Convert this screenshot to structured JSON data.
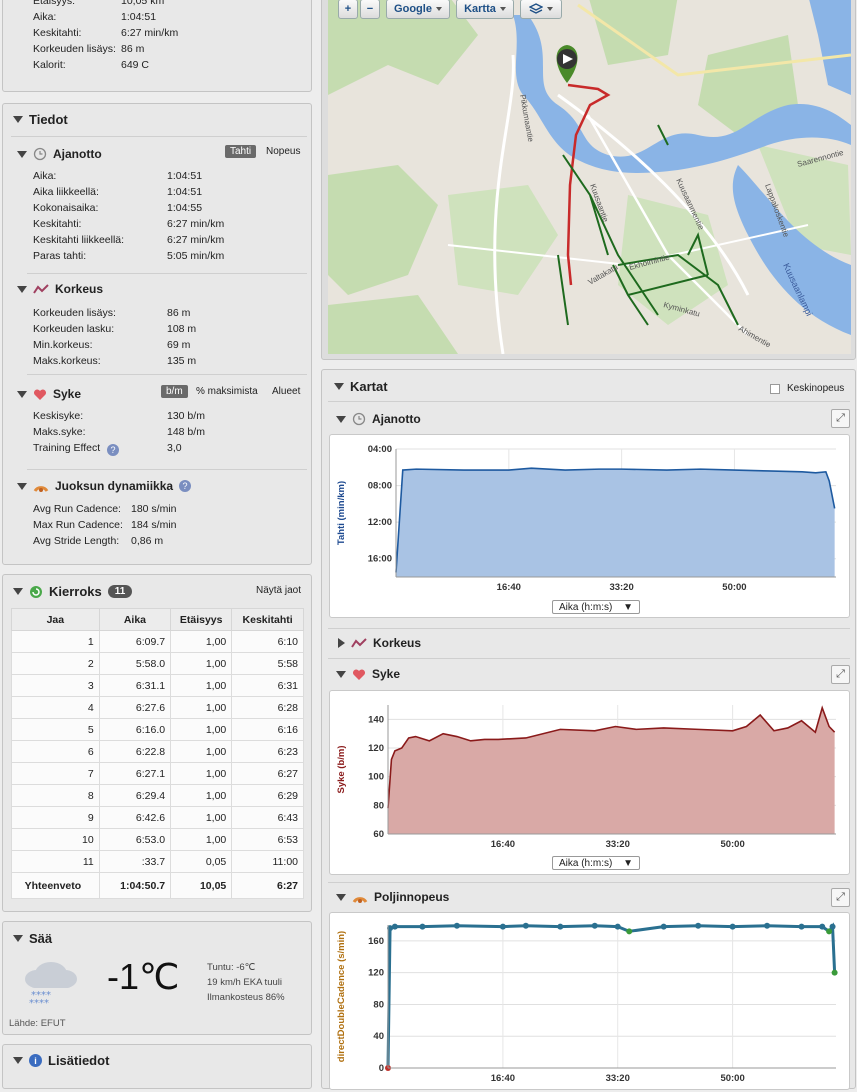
{
  "summary": {
    "rows": [
      {
        "label": "Etäisyys:",
        "value": "10,05 km"
      },
      {
        "label": "Aika:",
        "value": "1:04:51"
      },
      {
        "label": "Keskitahti:",
        "value": "6:27 min/km"
      },
      {
        "label": "Korkeuden lisäys:",
        "value": "86 m"
      },
      {
        "label": "Kalorit:",
        "value": "649 C"
      }
    ]
  },
  "tiedot": {
    "title": "Tiedot",
    "ajanotto": {
      "title": "Ajanotto",
      "toggle_a": "Tahti",
      "toggle_b": "Nopeus",
      "rows": [
        {
          "label": "Aika:",
          "value": "1:04:51"
        },
        {
          "label": "Aika liikkeellä:",
          "value": "1:04:51"
        },
        {
          "label": "Kokonaisaika:",
          "value": "1:04:55"
        },
        {
          "label": "Keskitahti:",
          "value": "6:27 min/km"
        },
        {
          "label": "Keskitahti liikkeellä:",
          "value": "6:27 min/km"
        },
        {
          "label": "Paras tahti:",
          "value": "5:05 min/km"
        }
      ]
    },
    "korkeus": {
      "title": "Korkeus",
      "rows": [
        {
          "label": "Korkeuden lisäys:",
          "value": "86 m"
        },
        {
          "label": "Korkeuden lasku:",
          "value": "108 m"
        },
        {
          "label": "Min.korkeus:",
          "value": "69 m"
        },
        {
          "label": "Maks.korkeus:",
          "value": "135 m"
        }
      ]
    },
    "syke": {
      "title": "Syke",
      "toggle_a": "b/m",
      "toggle_b": "% maksimista",
      "toggle_c": "Alueet",
      "rows": [
        {
          "label": "Keskisyke:",
          "value": "130 b/m"
        },
        {
          "label": "Maks.syke:",
          "value": "148 b/m"
        },
        {
          "label": "Training Effect",
          "value": "3,0"
        }
      ]
    },
    "dynamiikka": {
      "title": "Juoksun dynamiikka",
      "rows": [
        {
          "label": "Avg Run Cadence:",
          "value": "180 s/min"
        },
        {
          "label": "Max Run Cadence:",
          "value": "184 s/min"
        },
        {
          "label": "Avg Stride Length:",
          "value": "0,86 m"
        }
      ]
    }
  },
  "laps": {
    "title": "Kierroks",
    "count": "11",
    "show_splits": "Näytä jaot",
    "columns": [
      "Jaa",
      "Aika",
      "Etäisyys",
      "Keskitahti"
    ],
    "rows": [
      [
        "1",
        "6:09.7",
        "1,00",
        "6:10"
      ],
      [
        "2",
        "5:58.0",
        "1,00",
        "5:58"
      ],
      [
        "3",
        "6:31.1",
        "1,00",
        "6:31"
      ],
      [
        "4",
        "6:27.6",
        "1,00",
        "6:28"
      ],
      [
        "5",
        "6:16.0",
        "1,00",
        "6:16"
      ],
      [
        "6",
        "6:22.8",
        "1,00",
        "6:23"
      ],
      [
        "7",
        "6:27.1",
        "1,00",
        "6:27"
      ],
      [
        "8",
        "6:29.4",
        "1,00",
        "6:29"
      ],
      [
        "9",
        "6:42.6",
        "1,00",
        "6:43"
      ],
      [
        "10",
        "6:53.0",
        "1,00",
        "6:53"
      ],
      [
        "11",
        ":33.7",
        "0,05",
        "11:00"
      ]
    ],
    "total": [
      "Yhteenveto",
      "1:04:50.7",
      "10,05",
      "6:27"
    ]
  },
  "weather": {
    "title": "Sää",
    "temp": "-1℃",
    "feels": "Tuntu: -6℃",
    "wind": "19 km/h EKA tuuli",
    "humidity": "Ilmankosteus 86%",
    "source": "Lähde: EFUT"
  },
  "lisatiedot": {
    "title": "Lisätiedot"
  },
  "map": {
    "zoom_in": "+",
    "zoom_out": "−",
    "provider": "Google",
    "type": "Kartta",
    "streets": [
      "Pikkumaantie",
      "Kuusaantie",
      "Kuusaanmentie",
      "Ekholmintie",
      "Valtakatu",
      "Kyminkatu",
      "Ahimentie",
      "Saarennontie",
      "Lappakoskentie",
      "Kuusaanlampi"
    ]
  },
  "charts_panel": {
    "title": "Kartat",
    "avg_label": "Keskinopeus",
    "axis_select": "Aika (h:m:s)",
    "x_ticks": [
      "16:40",
      "33:20",
      "50:00"
    ],
    "pace": {
      "title": "Ajanotto",
      "ylabel": "Tahti (min/km)",
      "y_ticks": [
        "04:00",
        "08:00",
        "12:00",
        "16:00"
      ]
    },
    "korkeus": {
      "title": "Korkeus"
    },
    "syke": {
      "title": "Syke",
      "ylabel": "Syke (b/m)",
      "y_ticks": [
        "140",
        "120",
        "100",
        "80",
        "60"
      ]
    },
    "cadence": {
      "title": "Poljinnopeus",
      "ylabel": "directDoubleCadence (s/min)",
      "y_ticks": [
        "160",
        "120",
        "80",
        "40",
        "0"
      ]
    }
  },
  "chart_data": [
    {
      "type": "area",
      "title": "Ajanotto",
      "ylabel": "Tahti (min/km)",
      "xlabel": "Aika (h:m:s)",
      "x_unit": "min",
      "y_unit": "min/km",
      "ylim": [
        18,
        4
      ],
      "x": [
        0,
        1,
        3,
        10,
        16.67,
        20,
        25,
        30,
        33.33,
        40,
        45,
        50,
        55,
        60,
        62,
        63.5,
        64,
        64.8
      ],
      "values": [
        17.5,
        6.3,
        6.2,
        6.3,
        6.3,
        6.1,
        6.3,
        6.2,
        6.2,
        6.3,
        6.2,
        6.3,
        6.4,
        6.5,
        6.6,
        6.5,
        7.5,
        10.5
      ]
    },
    {
      "type": "area",
      "title": "Syke",
      "ylabel": "Syke (b/m)",
      "xlabel": "Aika (h:m:s)",
      "x_unit": "min",
      "ylim": [
        60,
        150
      ],
      "x": [
        0,
        0.5,
        1,
        2,
        3,
        4,
        6,
        8,
        10,
        12,
        14,
        16,
        20,
        25,
        30,
        33,
        36,
        40,
        45,
        50,
        52,
        54,
        56,
        58,
        60,
        62,
        63,
        64,
        64.8
      ],
      "values": [
        78,
        112,
        118,
        120,
        127,
        128,
        125,
        130,
        128,
        125,
        126,
        126,
        127,
        133,
        132,
        135,
        133,
        134,
        133,
        132,
        135,
        143,
        132,
        134,
        139,
        131,
        148,
        135,
        131
      ]
    },
    {
      "type": "scatter",
      "title": "Poljinnopeus",
      "ylabel": "directDoubleCadence (s/min)",
      "xlabel": "Aika (h:m:s)",
      "x_unit": "min",
      "ylim": [
        0,
        180
      ],
      "x": [
        0,
        0.3,
        1,
        5,
        10,
        16.67,
        20,
        25,
        30,
        33.33,
        35,
        40,
        45,
        50,
        55,
        60,
        63,
        64,
        64.5,
        64.8
      ],
      "values": [
        0,
        176,
        178,
        178,
        179,
        178,
        179,
        178,
        179,
        178,
        172,
        178,
        179,
        178,
        179,
        178,
        178,
        172,
        178,
        120
      ]
    }
  ]
}
